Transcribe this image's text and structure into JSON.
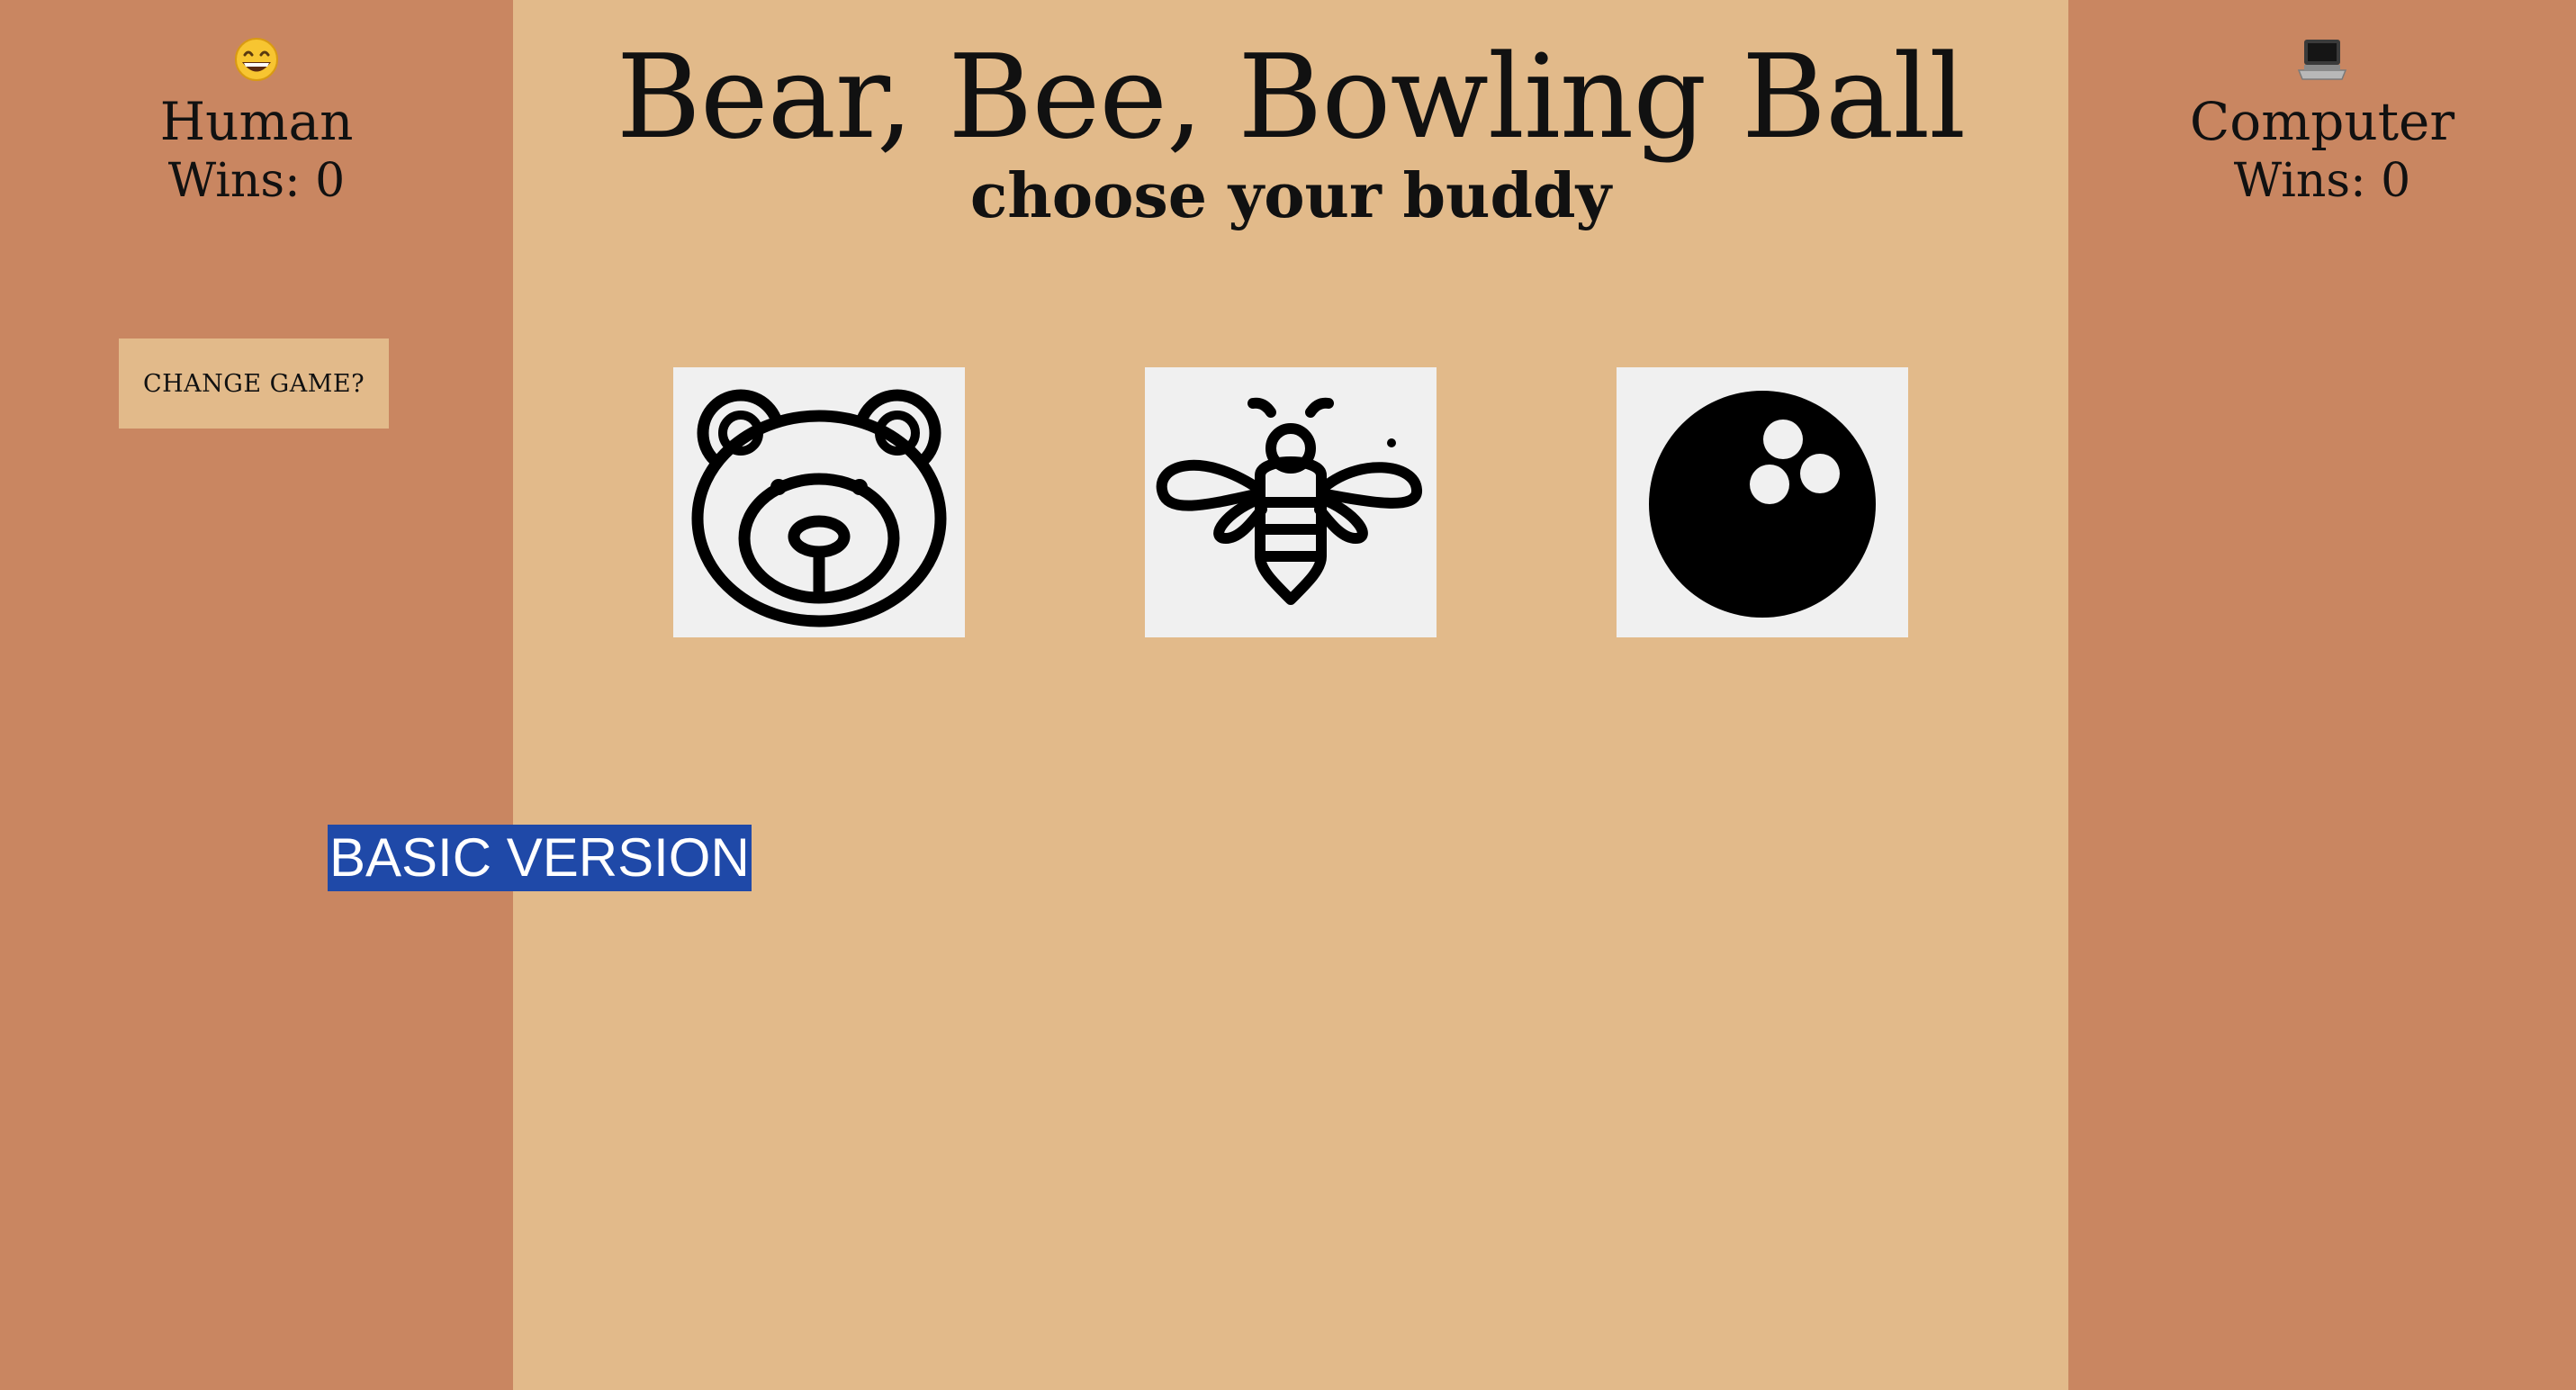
{
  "app": {
    "title": "Bear, Bee, Bowling Ball",
    "subtitle": "choose your buddy"
  },
  "human": {
    "icon": "grinning-face-emoji",
    "name": "Human",
    "wins": "Wins: 0"
  },
  "computer": {
    "icon": "laptop-emoji",
    "name": "Computer",
    "wins": "Wins: 0"
  },
  "change_game_label": "CHANGE GAME?",
  "choices": [
    {
      "icon": "bear-icon"
    },
    {
      "icon": "bee-icon"
    },
    {
      "icon": "bowling-ball-icon"
    }
  ],
  "mode_label": "BASIC VERSION",
  "colors": {
    "side_panel": "#c98661",
    "main_background": "#e2ba8a",
    "choice_card": "#f0f0f0",
    "mode_label_background": "#1f49a8"
  }
}
